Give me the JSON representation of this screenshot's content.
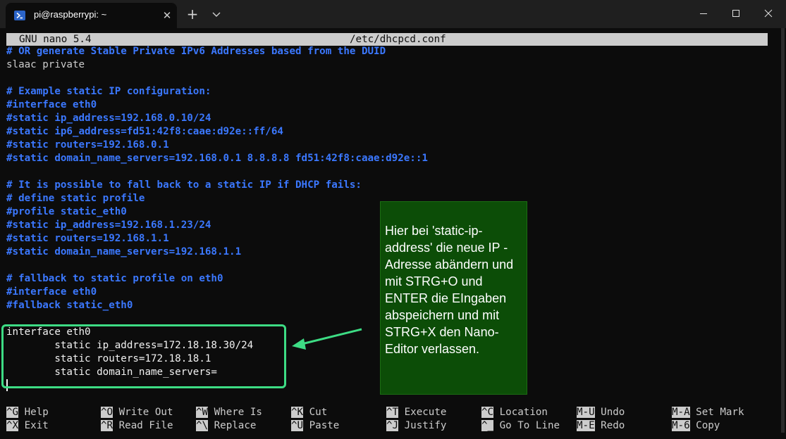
{
  "window": {
    "tab_title": "pi@raspberrypi: ~",
    "new_tab_symbol": "+",
    "tab_close_symbol": "✕",
    "icons": [
      "powershell-icon",
      "close-icon",
      "plus-icon",
      "chevron-down-icon",
      "minimize-icon",
      "maximize-icon",
      "close-window-icon"
    ]
  },
  "nano": {
    "version": "GNU nano 5.4",
    "filename": "/etc/dhcpcd.conf"
  },
  "file_lines": [
    {
      "text": "# OR generate Stable Private IPv6 Addresses based from the DUID",
      "style": "comment"
    },
    {
      "text": "slaac private",
      "style": "plain"
    },
    {
      "text": "",
      "style": "plain"
    },
    {
      "text": "# Example static IP configuration:",
      "style": "comment"
    },
    {
      "text": "#interface eth0",
      "style": "comment"
    },
    {
      "text": "#static ip_address=192.168.0.10/24",
      "style": "comment"
    },
    {
      "text": "#static ip6_address=fd51:42f8:caae:d92e::ff/64",
      "style": "comment"
    },
    {
      "text": "#static routers=192.168.0.1",
      "style": "comment"
    },
    {
      "text": "#static domain_name_servers=192.168.0.1 8.8.8.8 fd51:42f8:caae:d92e::1",
      "style": "comment"
    },
    {
      "text": "",
      "style": "plain"
    },
    {
      "text": "# It is possible to fall back to a static IP if DHCP fails:",
      "style": "comment"
    },
    {
      "text": "# define static profile",
      "style": "comment"
    },
    {
      "text": "#profile static_eth0",
      "style": "comment"
    },
    {
      "text": "#static ip_address=192.168.1.23/24",
      "style": "comment"
    },
    {
      "text": "#static routers=192.168.1.1",
      "style": "comment"
    },
    {
      "text": "#static domain_name_servers=192.168.1.1",
      "style": "comment"
    },
    {
      "text": "",
      "style": "plain"
    },
    {
      "text": "# fallback to static profile on eth0",
      "style": "comment"
    },
    {
      "text": "#interface eth0",
      "style": "comment"
    },
    {
      "text": "#fallback static_eth0",
      "style": "comment"
    },
    {
      "text": "",
      "style": "plain"
    },
    {
      "text": "interface eth0",
      "style": "bold-white"
    },
    {
      "text": "        static ip_address=172.18.18.30/24",
      "style": "bold-white"
    },
    {
      "text": "        static routers=172.18.18.1",
      "style": "bold-white"
    },
    {
      "text": "        static domain_name_servers=",
      "style": "bold-white"
    }
  ],
  "shortcuts_row1": [
    {
      "key": "^G",
      "label": "Help"
    },
    {
      "key": "^O",
      "label": "Write Out"
    },
    {
      "key": "^W",
      "label": "Where Is"
    },
    {
      "key": "^K",
      "label": "Cut"
    },
    {
      "key": "^T",
      "label": "Execute"
    },
    {
      "key": "^C",
      "label": "Location"
    },
    {
      "key": "M-U",
      "label": "Undo"
    },
    {
      "key": "M-A",
      "label": "Set Mark"
    }
  ],
  "shortcuts_row2": [
    {
      "key": "^X",
      "label": "Exit"
    },
    {
      "key": "^R",
      "label": "Read File"
    },
    {
      "key": "^\\",
      "label": "Replace"
    },
    {
      "key": "^U",
      "label": "Paste"
    },
    {
      "key": "^J",
      "label": "Justify"
    },
    {
      "key": "^_",
      "label": "Go To Line"
    },
    {
      "key": "M-E",
      "label": "Redo"
    },
    {
      "key": "M-6",
      "label": "Copy"
    }
  ],
  "annotation": {
    "note_text": "Hier bei 'static-ip-address' die neue IP -Adresse abändern und mit STRG+O und ENTER die EIngaben abspeichern und mit STRG+X den Nano-Editor verlassen.",
    "note_color": "#0c4d07",
    "highlight_color": "#3ddc84"
  },
  "colors": {
    "comment": "#3b78ff",
    "text": "#cccccc",
    "background": "#0c0c0c",
    "titlebar": "#1f1f1f"
  }
}
